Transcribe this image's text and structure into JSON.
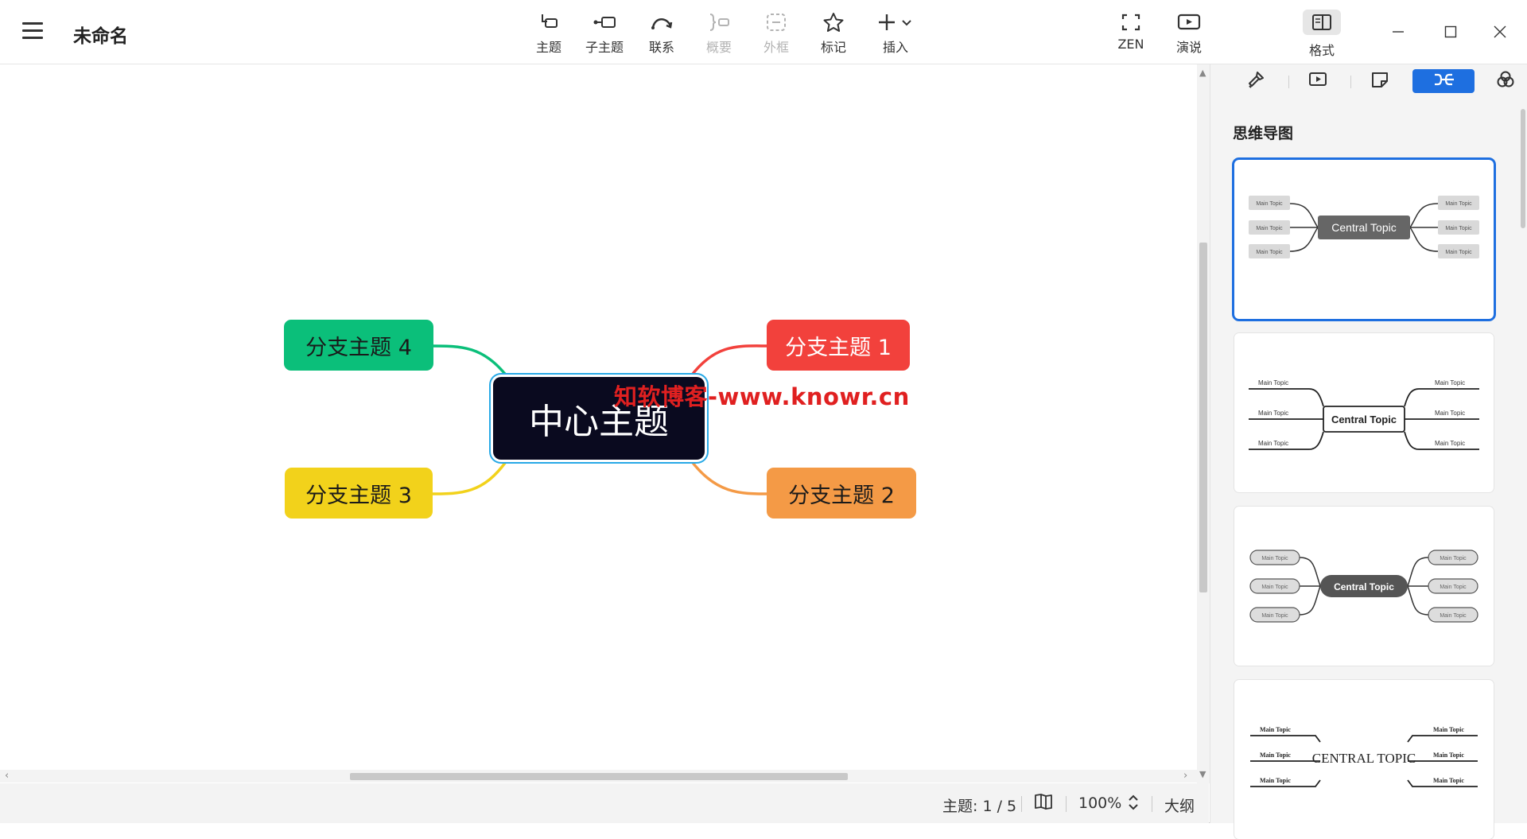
{
  "app": {
    "title": "未命名"
  },
  "toolbar": {
    "items": [
      {
        "key": "topic",
        "label": "主题",
        "icon": "topic-icon",
        "enabled": true
      },
      {
        "key": "subtopic",
        "label": "子主题",
        "icon": "subtopic-icon",
        "enabled": true
      },
      {
        "key": "relationship",
        "label": "联系",
        "icon": "relationship-icon",
        "enabled": true
      },
      {
        "key": "summary",
        "label": "概要",
        "icon": "summary-icon",
        "enabled": false
      },
      {
        "key": "boundary",
        "label": "外框",
        "icon": "boundary-icon",
        "enabled": false
      },
      {
        "key": "marker",
        "label": "标记",
        "icon": "star-icon",
        "enabled": true
      },
      {
        "key": "insert",
        "label": "插入",
        "icon": "plus-icon",
        "enabled": true
      }
    ],
    "zen_label": "ZEN",
    "present_label": "演说",
    "format_label": "格式"
  },
  "mindmap": {
    "central": {
      "label": "中心主题",
      "color": "#0a0a1f"
    },
    "branches": [
      {
        "label": "分支主题 1",
        "color": "#f2413c",
        "text_color": "#ffffff"
      },
      {
        "label": "分支主题 2",
        "color": "#f49a46",
        "text_color": "#1a1a1a"
      },
      {
        "label": "分支主题 3",
        "color": "#f2d21b",
        "text_color": "#1a1a1a"
      },
      {
        "label": "分支主题 4",
        "color": "#0bbf7a",
        "text_color": "#1a1a1a"
      }
    ],
    "watermark": "知软博客-www.knowr.cn"
  },
  "statusbar": {
    "topic_count": "主题: 1 / 5",
    "zoom": "100%",
    "outline_label": "大纲"
  },
  "panel": {
    "tabs": [
      "style-icon",
      "slideshow-icon",
      "sticker-icon",
      "mindmap-structure-icon",
      "theme-icon"
    ],
    "active_tab": 3,
    "title": "思维导图",
    "cards": [
      {
        "central": "Central Topic",
        "branch": "Main Topic"
      },
      {
        "central": "Central Topic",
        "branch": "Main Topic"
      },
      {
        "central": "Central Topic",
        "branch": "Main Topic"
      },
      {
        "central": "CENTRAL TOPIC",
        "branch": "Main Topic"
      }
    ]
  }
}
